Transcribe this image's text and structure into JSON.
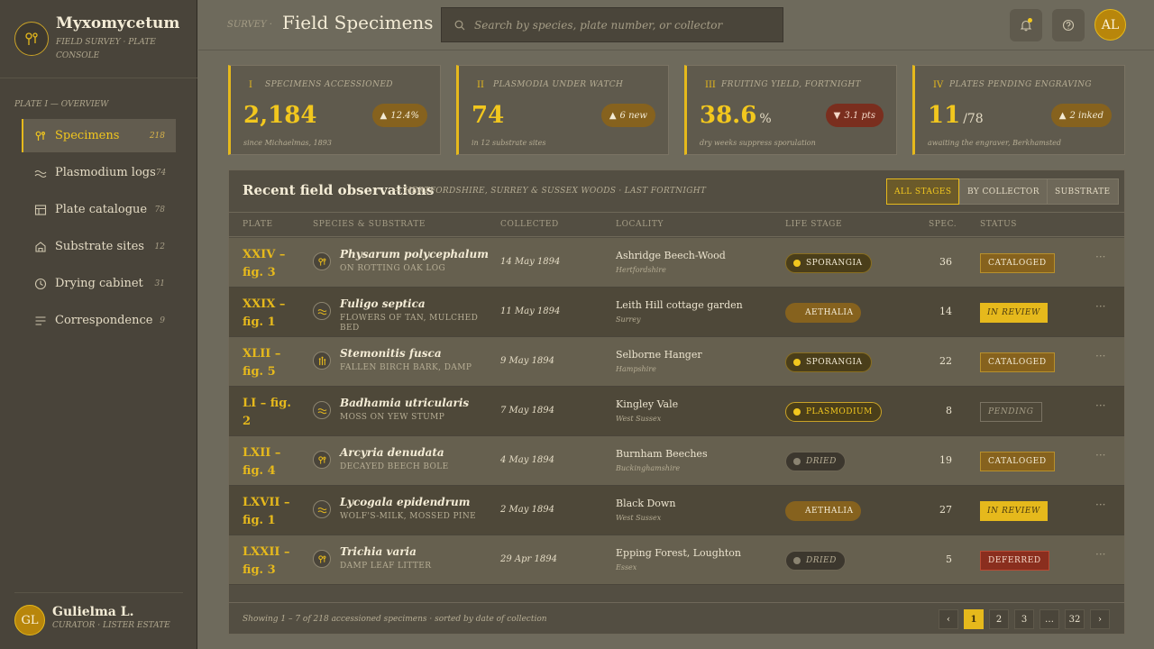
{
  "brand": {
    "title": "Myxomycetum",
    "subtitle": "FIELD SURVEY · PLATE CONSOLE",
    "logo_icon": "spore-logo-icon"
  },
  "sidebar": {
    "heading": "PLATE I — OVERVIEW",
    "items": [
      {
        "label": "Specimens",
        "count": "218",
        "icon": "spore-icon",
        "active": true
      },
      {
        "label": "Plasmodium logs",
        "count": "74",
        "icon": "wave-icon",
        "active": false
      },
      {
        "label": "Plate catalogue",
        "count": "78",
        "icon": "plate-icon",
        "active": false
      },
      {
        "label": "Substrate sites",
        "count": "12",
        "icon": "site-icon",
        "active": false
      },
      {
        "label": "Drying cabinet",
        "count": "31",
        "icon": "clock-icon",
        "active": false
      },
      {
        "label": "Correspondence",
        "count": "9",
        "icon": "lines-icon",
        "active": false
      }
    ]
  },
  "user": {
    "initials": "GL",
    "name": "Gulielma L.",
    "role": "CURATOR · LISTER ESTATE"
  },
  "header": {
    "crumb": "SURVEY ·",
    "title": "Field Specimens",
    "search_placeholder": "Search by species, plate number, or collector",
    "avatar_initials": "AL"
  },
  "stats": [
    {
      "numeral": "I",
      "label": "SPECIMENS ACCESSIONED",
      "value": "2,184",
      "unit": "",
      "note": "since Michaelmas, 1893",
      "delta": "12.4%",
      "direction": "up"
    },
    {
      "numeral": "II",
      "label": "PLASMODIA UNDER WATCH",
      "value": "74",
      "unit": "",
      "note": "in 12 substrate sites",
      "delta": "6 new",
      "direction": "up"
    },
    {
      "numeral": "III",
      "label": "FRUITING YIELD, FORTNIGHT",
      "value": "38.6",
      "unit": "%",
      "note": "dry weeks suppress sporulation",
      "delta": "3.1 pts",
      "direction": "down"
    },
    {
      "numeral": "IV",
      "label": "PLATES PENDING ENGRAVING",
      "value": "11",
      "unit": "/78",
      "note": "awaiting the engraver, Berkhamsted",
      "delta": "2 inked",
      "direction": "up"
    }
  ],
  "table": {
    "title": "Recent field observations",
    "subtitle": "— HERTFORDSHIRE, SURREY & SUSSEX WOODS · LAST FORTNIGHT",
    "filters": [
      "ALL STAGES",
      "BY COLLECTOR",
      "SUBSTRATE"
    ],
    "columns": [
      "PLATE",
      "SPECIES & SUBSTRATE",
      "COLLECTED",
      "LOCALITY",
      "LIFE STAGE",
      "SPEC.",
      "STATUS"
    ],
    "rows": [
      {
        "plate": "XXIV – fig. 3",
        "species": "Physarum polycephalum",
        "substrate": "ON ROTTING OAK LOG",
        "collected": "14 May 1894",
        "locality": "Ashridge Beech-Wood",
        "county": "Hertfordshire",
        "stage": "SPORANGIA",
        "stage_class": "sporangia",
        "spec": "36",
        "status": "CATALOGED",
        "status_class": "cataloged",
        "icon": "spore-icon"
      },
      {
        "plate": "XXIX – fig. 1",
        "species": "Fuligo septica",
        "substrate": "FLOWERS OF TAN, MULCHED BED",
        "collected": "11 May 1894",
        "locality": "Leith Hill cottage garden",
        "county": "Surrey",
        "stage": "AETHALIA",
        "stage_class": "aethalia",
        "spec": "14",
        "status": "IN REVIEW",
        "status_class": "review",
        "icon": "wave-icon"
      },
      {
        "plate": "XLII – fig. 5",
        "species": "Stemonitis fusca",
        "substrate": "FALLEN BIRCH BARK, DAMP",
        "collected": "9 May 1894",
        "locality": "Selborne Hanger",
        "county": "Hampshire",
        "stage": "SPORANGIA",
        "stage_class": "sporangia",
        "spec": "22",
        "status": "CATALOGED",
        "status_class": "cataloged",
        "icon": "stalk-icon"
      },
      {
        "plate": "LI – fig. 2",
        "species": "Badhamia utricularis",
        "substrate": "MOSS ON YEW STUMP",
        "collected": "7 May 1894",
        "locality": "Kingley Vale",
        "county": "West Sussex",
        "stage": "PLASMODIUM",
        "stage_class": "plasmodium",
        "spec": "8",
        "status": "PENDING",
        "status_class": "pending",
        "icon": "wave-icon"
      },
      {
        "plate": "LXII – fig. 4",
        "species": "Arcyria denudata",
        "substrate": "DECAYED BEECH BOLE",
        "collected": "4 May 1894",
        "locality": "Burnham Beeches",
        "county": "Buckinghamshire",
        "stage": "DRIED",
        "stage_class": "dried",
        "spec": "19",
        "status": "CATALOGED",
        "status_class": "cataloged",
        "icon": "spore-icon"
      },
      {
        "plate": "LXVII – fig. 1",
        "species": "Lycogala epidendrum",
        "substrate": "WOLF'S-MILK, MOSSED PINE",
        "collected": "2 May 1894",
        "locality": "Black Down",
        "county": "West Sussex",
        "stage": "AETHALIA",
        "stage_class": "aethalia",
        "spec": "27",
        "status": "IN REVIEW",
        "status_class": "review",
        "icon": "wave-icon"
      },
      {
        "plate": "LXXII – fig. 3",
        "species": "Trichia varia",
        "substrate": "DAMP LEAF LITTER",
        "collected": "29 Apr 1894",
        "locality": "Epping Forest, Loughton",
        "county": "Essex",
        "stage": "DRIED",
        "stage_class": "dried",
        "spec": "5",
        "status": "DEFERRED",
        "status_class": "deferred",
        "icon": "spore-icon"
      }
    ],
    "footer": "Showing 1 – 7 of 218 accessioned specimens · sorted by date of collection",
    "pages": [
      "‹",
      "1",
      "2",
      "3",
      "…",
      "32",
      "›"
    ],
    "current_page": "1"
  },
  "colors": {
    "accent": "#e6b91c",
    "sidebar": "#49443a",
    "background": "#6e6a5c",
    "deferred": "#8a2e1e"
  }
}
